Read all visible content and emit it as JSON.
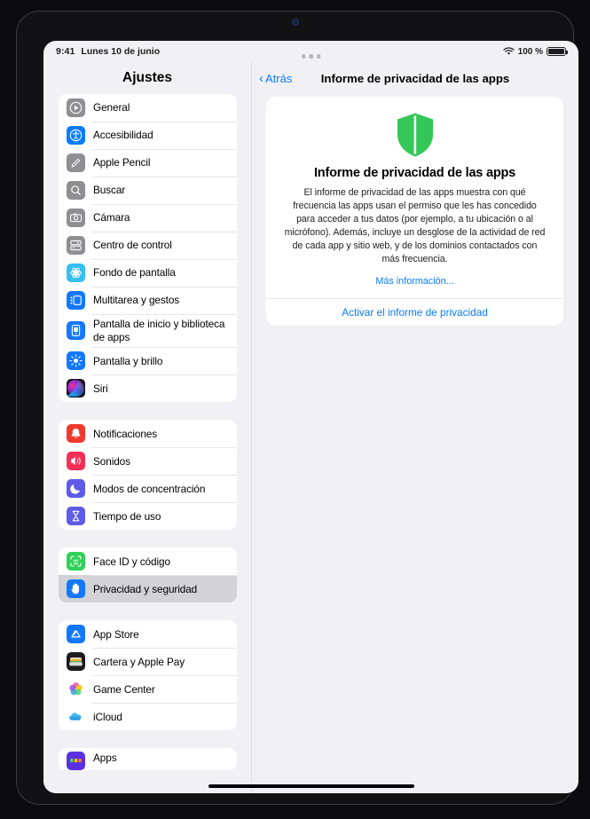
{
  "status_bar": {
    "time": "9:41",
    "date": "Lunes 10 de junio",
    "battery_percent": "100 %",
    "wifi_icon": "wifi-icon",
    "battery_icon": "battery-full-icon"
  },
  "sidebar": {
    "title": "Ajustes",
    "groups": [
      {
        "items": [
          {
            "label": "General",
            "icon": "gear-icon",
            "color": "#8e8e93",
            "selected": false
          },
          {
            "label": "Accesibilidad",
            "icon": "accessibility-icon",
            "color": "#0a7cff",
            "selected": false
          },
          {
            "label": "Apple Pencil",
            "icon": "pencil-icon",
            "color": "#8e8e93",
            "selected": false
          },
          {
            "label": "Buscar",
            "icon": "search-icon",
            "color": "#8e8e93",
            "selected": false
          },
          {
            "label": "Cámara",
            "icon": "camera-icon",
            "color": "#8e8e93",
            "selected": false
          },
          {
            "label": "Centro de control",
            "icon": "control-center-icon",
            "color": "#8e8e93",
            "selected": false
          },
          {
            "label": "Fondo de pantalla",
            "icon": "wallpaper-icon",
            "color": "#35c0f0",
            "selected": false
          },
          {
            "label": "Multitarea y gestos",
            "icon": "multitasking-icon",
            "color": "#1478ff",
            "selected": false
          },
          {
            "label": "Pantalla de inicio y biblioteca de apps",
            "icon": "home-screen-icon",
            "color": "#1478ff",
            "selected": false
          },
          {
            "label": "Pantalla y brillo",
            "icon": "brightness-icon",
            "color": "#1478ff",
            "selected": false
          },
          {
            "label": "Siri",
            "icon": "siri-icon",
            "color": "#2b1a3a",
            "selected": false
          }
        ]
      },
      {
        "items": [
          {
            "label": "Notificaciones",
            "icon": "bell-icon",
            "color": "#f03a2e",
            "selected": false
          },
          {
            "label": "Sonidos",
            "icon": "speaker-icon",
            "color": "#f62f57",
            "selected": false
          },
          {
            "label": "Modos de concentración",
            "icon": "moon-icon",
            "color": "#5e5ce6",
            "selected": false
          },
          {
            "label": "Tiempo de uso",
            "icon": "hourglass-icon",
            "color": "#5e5ce6",
            "selected": false
          }
        ]
      },
      {
        "items": [
          {
            "label": "Face ID y código",
            "icon": "face-id-icon",
            "color": "#30d158",
            "selected": false
          },
          {
            "label": "Privacidad y seguridad",
            "icon": "hand-raised-icon",
            "color": "#1478ff",
            "selected": true
          }
        ]
      },
      {
        "items": [
          {
            "label": "App Store",
            "icon": "app-store-icon",
            "color": "#1478ff",
            "selected": false
          },
          {
            "label": "Cartera y Apple Pay",
            "icon": "wallet-icon",
            "color": "#1c1c1e",
            "selected": false
          },
          {
            "label": "Game Center",
            "icon": "game-center-icon",
            "color": "#ffffff",
            "selected": false
          },
          {
            "label": "iCloud",
            "icon": "icloud-icon",
            "color": "#ffffff",
            "selected": false
          }
        ]
      },
      {
        "items": [
          {
            "label": "Apps",
            "icon": "apps-icon",
            "color": "#5b30e0",
            "selected": false
          }
        ]
      }
    ]
  },
  "detail": {
    "back_label": "Atrás",
    "back_icon": "chevron-left-icon",
    "nav_title": "Informe de privacidad de las apps",
    "card": {
      "icon": "shield-icon",
      "icon_color": "#34c759",
      "title": "Informe de privacidad de las apps",
      "body": "El informe de privacidad de las apps muestra con qué frecuencia las apps usan el permiso que les has concedido para acceder a tus datos (por ejemplo, a tu ubicación o al micrófono). Además, incluye un desglose de la actividad de red de cada app y sitio web, y de los dominios contactados con más frecuencia.",
      "more_link": "Más información...",
      "action_label": "Activar el informe de privacidad"
    }
  },
  "colors": {
    "accent": "#0a7cff",
    "selected_row": "#d2d2d7",
    "background": "#f1f1f5"
  }
}
